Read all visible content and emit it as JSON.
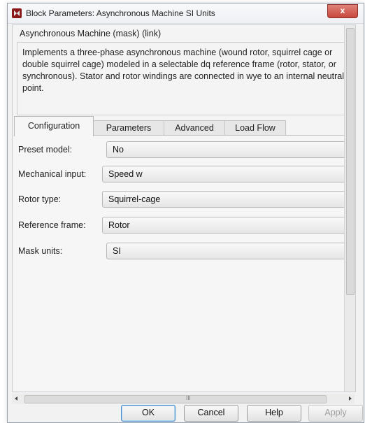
{
  "window": {
    "title": "Block Parameters: Asynchronous Machine SI Units",
    "close_label": "x"
  },
  "mask": {
    "title": "Asynchronous Machine (mask) (link)",
    "description": "Implements a three-phase asynchronous machine (wound rotor, squirrel cage or double squirrel cage) modeled in a selectable dq reference frame (rotor, stator, or synchronous). Stator and rotor windings are connected in wye to an internal neutral point."
  },
  "tabs": [
    {
      "label": "Configuration",
      "active": true
    },
    {
      "label": "Parameters",
      "active": false
    },
    {
      "label": "Advanced",
      "active": false
    },
    {
      "label": "Load Flow",
      "active": false
    }
  ],
  "config": {
    "preset_model": {
      "label": "Preset model:",
      "value": "No"
    },
    "mechanical_input": {
      "label": "Mechanical input:",
      "value": "Speed w"
    },
    "rotor_type": {
      "label": "Rotor type:",
      "value": "Squirrel-cage"
    },
    "reference_frame": {
      "label": "Reference frame:",
      "value": "Rotor"
    },
    "mask_units": {
      "label": "Mask units:",
      "value": "SI"
    }
  },
  "buttons": {
    "ok": "OK",
    "cancel": "Cancel",
    "help": "Help",
    "apply": "Apply"
  },
  "scrollbar": {
    "grip": "III"
  }
}
